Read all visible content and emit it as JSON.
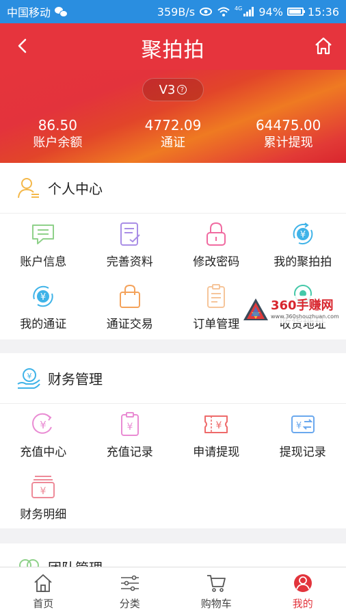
{
  "status_bar": {
    "carrier": "中国移动",
    "speed": "359B/s",
    "signal_tag": "4G",
    "battery": "94%",
    "time": "15:36"
  },
  "header": {
    "title": "聚拍拍",
    "level": "V3",
    "help": "?"
  },
  "stats": [
    {
      "value": "86.50",
      "label": "账户余额"
    },
    {
      "value": "4772.09",
      "label": "通证"
    },
    {
      "value": "64475.00",
      "label": "累计提现"
    }
  ],
  "personal": {
    "title": "个人中心",
    "items": [
      {
        "label": "账户信息",
        "icon": "message-icon",
        "color": "#8fd18a"
      },
      {
        "label": "完善资料",
        "icon": "edit-document-icon",
        "color": "#a98ee6"
      },
      {
        "label": "修改密码",
        "icon": "lock-icon",
        "color": "#f06aa0"
      },
      {
        "label": "我的聚拍拍",
        "icon": "yen-cycle-icon",
        "color": "#3fb3e8"
      },
      {
        "label": "我的通证",
        "icon": "yen-refresh-icon",
        "color": "#3fb3e8"
      },
      {
        "label": "通证交易",
        "icon": "shopping-bag-icon",
        "color": "#f4a25a"
      },
      {
        "label": "订单管理",
        "icon": "clipboard-icon",
        "color": "#f6c59a"
      },
      {
        "label": "收货地址",
        "icon": "location-icon",
        "color": "#44c8a8"
      }
    ]
  },
  "finance": {
    "title": "财务管理",
    "items": [
      {
        "label": "充值中心",
        "icon": "yen-circle-icon",
        "color": "#e98bd3"
      },
      {
        "label": "充值记录",
        "icon": "yen-clipboard-icon",
        "color": "#e98bd3"
      },
      {
        "label": "申请提现",
        "icon": "yen-ticket-icon",
        "color": "#ee6a6a"
      },
      {
        "label": "提现记录",
        "icon": "yen-transfer-icon",
        "color": "#6aa8ee"
      },
      {
        "label": "财务明细",
        "icon": "yen-stack-icon",
        "color": "#ee8a98"
      }
    ]
  },
  "team": {
    "title": "团队管理"
  },
  "bottom_nav": [
    {
      "label": "首页",
      "icon": "home-icon"
    },
    {
      "label": "分类",
      "icon": "sliders-icon"
    },
    {
      "label": "购物车",
      "icon": "cart-icon"
    },
    {
      "label": "我的",
      "icon": "user-icon",
      "active": true
    }
  ],
  "watermark": {
    "main": "360手赚网",
    "sub": "www.360shouzhuan.com"
  },
  "colors": {
    "brand": "#e2343c",
    "status_bar": "#2a8ee0"
  }
}
